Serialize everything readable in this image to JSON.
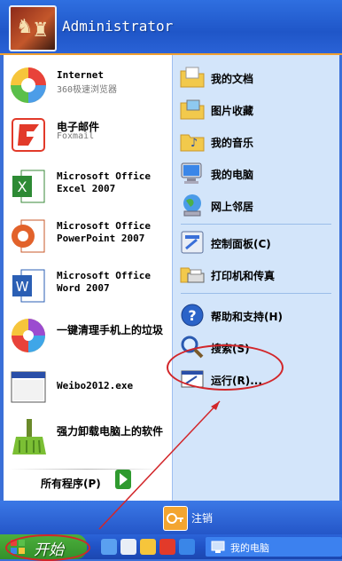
{
  "user": {
    "name": "Administrator"
  },
  "left_programs": [
    {
      "name": "Internet",
      "sub": "360极速浏览器"
    },
    {
      "name": "电子邮件",
      "sub": "Foxmail"
    },
    {
      "name": "Microsoft Office",
      "sub": "Excel 2007"
    },
    {
      "name": "Microsoft Office",
      "sub": "PowerPoint 2007"
    },
    {
      "name": "Microsoft Office",
      "sub": "Word 2007"
    },
    {
      "name": "一键清理手机上的垃圾"
    },
    {
      "name": "Weibo2012.exe"
    },
    {
      "name": "强力卸载电脑上的软件"
    }
  ],
  "all_programs": "所有程序(P)",
  "right_items": [
    {
      "label": "我的文档"
    },
    {
      "label": "图片收藏"
    },
    {
      "label": "我的音乐"
    },
    {
      "label": "我的电脑"
    },
    {
      "label": "网上邻居"
    },
    {
      "label": "控制面板(C)"
    },
    {
      "label": "打印机和传真"
    },
    {
      "label": "帮助和支持(H)"
    },
    {
      "label": "搜索(S)"
    },
    {
      "label": "运行(R)..."
    }
  ],
  "footer": {
    "logoff": "注销"
  },
  "taskbar": {
    "start": "开始",
    "window_button": "我的电脑"
  },
  "annotation_color": "#d2262a"
}
